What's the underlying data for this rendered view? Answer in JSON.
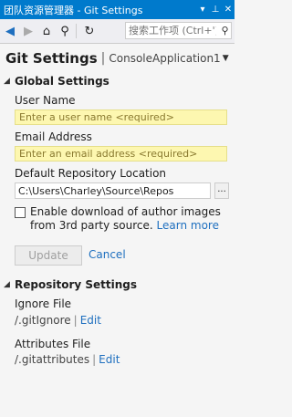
{
  "window": {
    "title": "团队资源管理器 - Git Settings",
    "pin_icon": "pin-icon",
    "close_icon": "close-icon",
    "menu_icon": "dropdown-icon"
  },
  "toolbar": {
    "search_placeholder": "搜索工作项 (Ctrl+')",
    "search_icon": "search-icon"
  },
  "header": {
    "title": "Git Settings",
    "separator": "|",
    "repo": "ConsoleApplication1"
  },
  "global": {
    "heading": "Global Settings",
    "user_name_label": "User Name",
    "user_name_placeholder": "Enter a user name <required>",
    "email_label": "Email Address",
    "email_placeholder": "Enter an email address <required>",
    "repo_location_label": "Default Repository Location",
    "repo_location_value": "C:\\Users\\Charley\\Source\\Repos",
    "browse_label": "...",
    "author_images_line1": "Enable download of author images",
    "author_images_line2": "from 3rd party source.",
    "learn_more": "Learn more",
    "update_label": "Update",
    "cancel_label": "Cancel"
  },
  "repository": {
    "heading": "Repository Settings",
    "ignore_label": "Ignore File",
    "ignore_file": "/.gitIgnore",
    "ignore_edit": "Edit",
    "attributes_label": "Attributes File",
    "attributes_file": "/.gitattributes",
    "attributes_edit": "Edit",
    "pipe": "|"
  }
}
